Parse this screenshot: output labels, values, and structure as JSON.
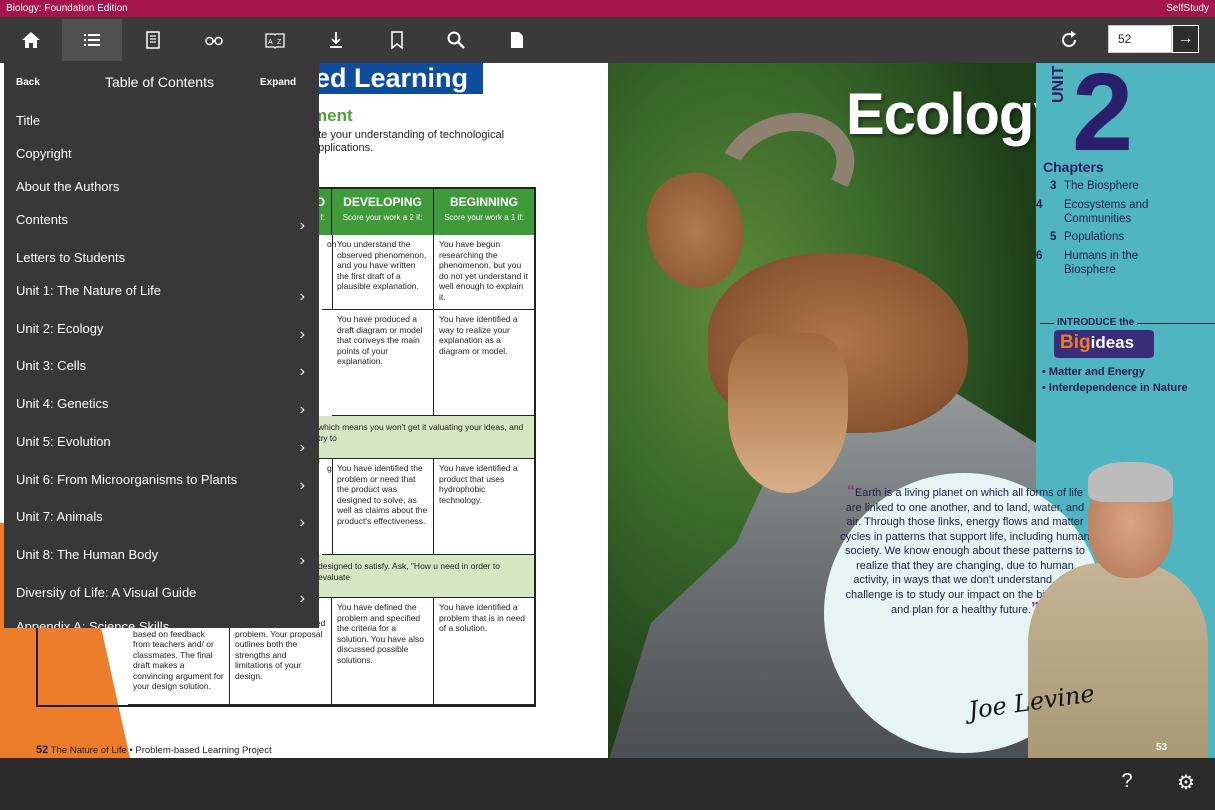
{
  "window": {
    "title": "Biology: Foundation Edition",
    "app_name": "SelfStudy"
  },
  "toolbar": {
    "buttons": [
      {
        "name": "home",
        "icon": "home-icon"
      },
      {
        "name": "table-of-contents",
        "icon": "list-icon",
        "active": true
      },
      {
        "name": "notes",
        "icon": "notes-icon"
      },
      {
        "name": "reading-view",
        "icon": "glasses-icon"
      },
      {
        "name": "dictionary",
        "icon": "book-dictionary-icon"
      },
      {
        "name": "download",
        "icon": "download-icon"
      },
      {
        "name": "bookmark",
        "icon": "bookmark-icon"
      },
      {
        "name": "search",
        "icon": "search-icon"
      },
      {
        "name": "page",
        "icon": "document-icon"
      }
    ],
    "page_number": "52",
    "go_label": "→",
    "refresh_icon": "refresh-icon"
  },
  "toc": {
    "back_label": "Back",
    "title": "Table of Contents",
    "expand_label": "Expand",
    "items": [
      {
        "label": "Title",
        "has_children": false
      },
      {
        "label": "Copyright",
        "has_children": false
      },
      {
        "label": "About the Authors",
        "has_children": false
      },
      {
        "label": "Contents",
        "has_children": true
      },
      {
        "label": "Letters to Students",
        "has_children": false
      },
      {
        "label": "Unit 1: The Nature of Life",
        "has_children": true
      },
      {
        "label": "Unit 2: Ecology",
        "has_children": true
      },
      {
        "label": "Unit 3: Cells",
        "has_children": true
      },
      {
        "label": "Unit 4: Genetics",
        "has_children": true
      },
      {
        "label": "Unit 5: Evolution",
        "has_children": true
      },
      {
        "label": "Unit 6: From Microorganisms to Plants",
        "has_children": true
      },
      {
        "label": "Unit 7: Animals",
        "has_children": true
      },
      {
        "label": "Unit 8: The Human Body",
        "has_children": true
      },
      {
        "label": "Diversity of Life: A Visual Guide",
        "has_children": true
      },
      {
        "label": "Appendix A: Science Skills",
        "has_children": true
      }
    ]
  },
  "left_page": {
    "heading": "ed Learning",
    "subheading": "ment",
    "intro": "ate your understanding of technological applications.",
    "rubric": {
      "headers": [
        {
          "title": "D",
          "sub": "f:"
        },
        {
          "title": "DEVELOPING",
          "sub": "Score your work a 2 if:"
        },
        {
          "title": "BEGINNING",
          "sub": "Score your work a 1 if:"
        }
      ],
      "row1": {
        "col1": "on",
        "developing": "You understand the observed phenomenon, and you have written the first draft of a plausible explanation.",
        "beginning": "You have begun researching the phenomenon, but you do not yet understand it well enough to explain it."
      },
      "row2": {
        "developing": "You have produced a draft diagram or model that conveys the main points of your explanation.",
        "beginning": "You have identified a way to realize your explanation as a diagram or model."
      },
      "band1": "which means you won't get it valuating your ideas, and try to",
      "row3": {
        "col1": "g",
        "developing": "You have identified the problem or need that the product was designed to solve, as well as claims about the product's effectiveness.",
        "beginning": "You have identified a product that uses hydrophobic technology."
      },
      "band2": "designed to satisfy. Ask, \"How u need in order to evaluate",
      "row4": {
        "col0": "You design proposal based on feedback from teachers and/ or classmates. The final draft makes a convincing argument for your design solution.",
        "col1": "a solution to the defined problem. Your proposal outlines both the strengths and limitations of your design.",
        "developing": "You have defined the problem and specified the criteria for a solution. You have also discussed possible solutions.",
        "beginning": "You have identified a problem that is in need of a solution."
      }
    },
    "footer_page": "52",
    "footer_text": "The Nature of Life • Problem-based Learning Project"
  },
  "right_page": {
    "title": "Ecology",
    "unit_label": "UNIT",
    "unit_number": "2",
    "chapters_title": "Chapters",
    "chapters": [
      {
        "num": "3",
        "name": "The Biosphere"
      },
      {
        "num": "4",
        "name": "Ecosystems and Communities"
      },
      {
        "num": "5",
        "name": "Populations"
      },
      {
        "num": "6",
        "name": "Humans in the Biosphere"
      }
    ],
    "introduce_label": "INTRODUCE the",
    "big_label": "Big",
    "ideas_label": "ideas",
    "big_ideas": [
      "Matter and Energy",
      "Interdependence in Nature"
    ],
    "quote": "Earth is a living planet on which all forms of life are linked to one another, and to land, water, and air. Through those links, energy flows and matter cycles in patterns that support life, including human society. We know enough about these patterns to realize that they are changing, due to human activity, in ways that we don't understand. Our challenge is to study our impact on the biosphere and plan for a healthy future.",
    "signature": "Joe Levine",
    "page_number": "53"
  },
  "bottom_bar": {
    "help_label": "?",
    "settings_label": "⚙"
  }
}
